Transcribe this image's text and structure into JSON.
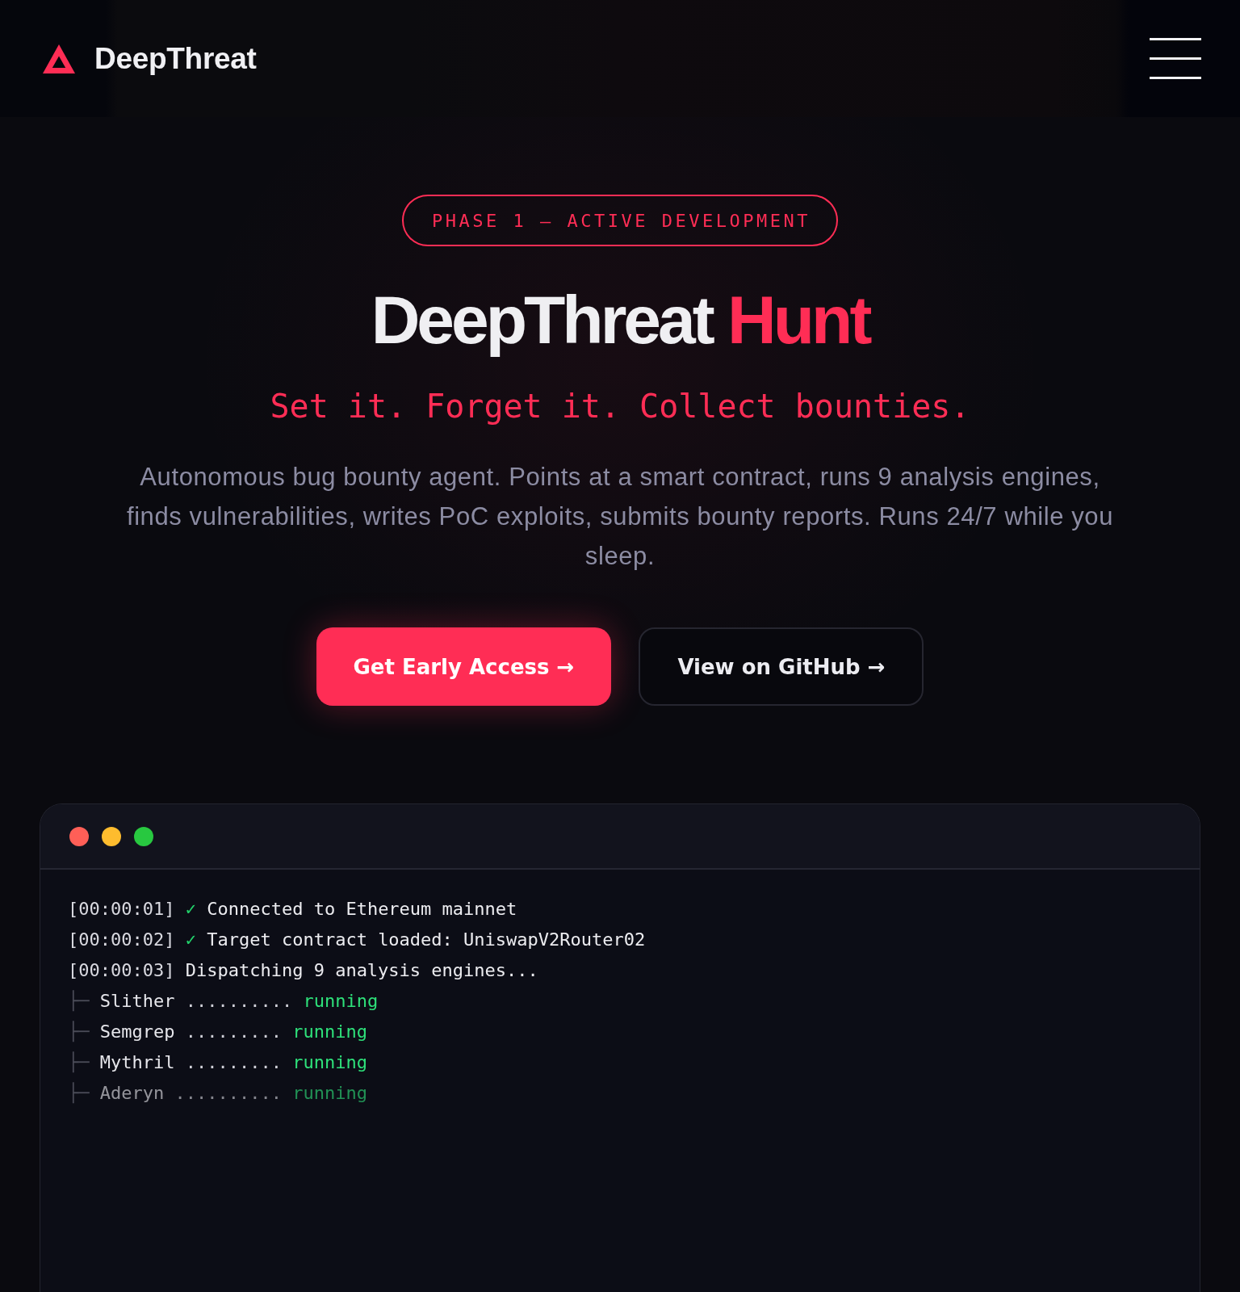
{
  "header": {
    "brand": "DeepThreat"
  },
  "hero": {
    "badge": "PHASE 1 — ACTIVE DEVELOPMENT",
    "title": "DeepThreat",
    "title_accent": "Hunt",
    "tagline": "Set it. Forget it. Collect bounties.",
    "description": "Autonomous bug bounty agent. Points at a smart contract, runs 9 analysis engines, finds vulnerabilities, writes PoC exploits, submits bounty reports. Runs 24/7 while you sleep.",
    "buttons": [
      {
        "label": "Get Early Access →",
        "kind": "primary"
      },
      {
        "label": "View on GitHub →",
        "kind": "secondary"
      }
    ]
  },
  "terminal": {
    "lines": [
      {
        "kind": "log",
        "time": "[00:00:01]",
        "check": "✓",
        "text": "Connected to Ethereum mainnet"
      },
      {
        "kind": "log",
        "time": "[00:00:02]",
        "check": "✓",
        "text": "Target contract loaded: UniswapV2Router02"
      },
      {
        "kind": "log",
        "time": "[00:00:03]",
        "text": "Dispatching 9 analysis engines..."
      },
      {
        "kind": "engine",
        "branch": "├─",
        "name": "Slither",
        "leader": "..........",
        "status": "running",
        "dimmed": false
      },
      {
        "kind": "engine",
        "branch": "├─",
        "name": "Semgrep",
        "leader": ".........",
        "status": "running",
        "dimmed": false
      },
      {
        "kind": "engine",
        "branch": "├─",
        "name": "Mythril",
        "leader": ".........",
        "status": "running",
        "dimmed": false
      },
      {
        "kind": "engine",
        "branch": "├─",
        "name": "Aderyn",
        "leader": "..........",
        "status": "running",
        "dimmed": true
      }
    ]
  }
}
